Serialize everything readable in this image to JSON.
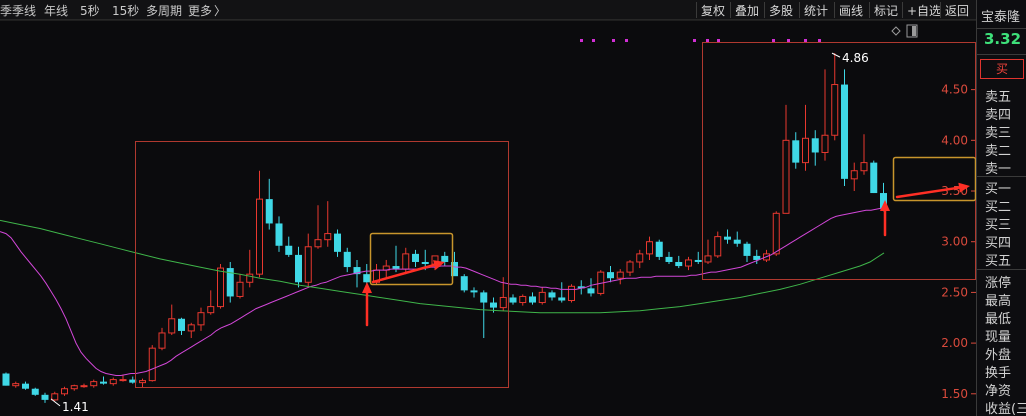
{
  "toolbar": {
    "periods": [
      "季",
      "季线",
      "年线",
      "5秒",
      "15秒",
      "多周期",
      "更多"
    ],
    "more_arrow": "〉",
    "tools": [
      "复权",
      "叠加",
      "多股",
      "统计",
      "画线",
      "标记",
      "+自选",
      "返回"
    ]
  },
  "stock": {
    "name": "宝泰隆",
    "price": "3.32",
    "buy_label": "买"
  },
  "orderbook": {
    "sell": [
      "卖五",
      "卖四",
      "卖三",
      "卖二",
      "卖一"
    ],
    "buy": [
      "买一",
      "买二",
      "买三",
      "买四",
      "买五"
    ]
  },
  "stats": [
    "涨停",
    "最高",
    "最低",
    "现量",
    "外盘",
    "换手",
    "净资",
    "收益(三)"
  ],
  "colors": {
    "up": "#e8382f",
    "down": "#3fd8e6",
    "ma_short": "#d247d8",
    "ma_long": "#3fb54a",
    "box_red": "#b0392f",
    "box_gold": "#c8952c",
    "arrow": "#ff2f25",
    "marker": "#d12fd4",
    "axis_text": "#d94a3c"
  },
  "chart_data": {
    "type": "candlestick",
    "ylim": [
      1.35,
      4.95
    ],
    "y_ticks": [
      "4.50",
      "4.00",
      "3.50",
      "3.00",
      "2.50",
      "2.00",
      "1.50"
    ],
    "ohlc": [
      [
        1.7,
        1.71,
        1.58,
        1.58
      ],
      [
        1.58,
        1.62,
        1.56,
        1.6
      ],
      [
        1.6,
        1.62,
        1.54,
        1.55
      ],
      [
        1.55,
        1.56,
        1.48,
        1.49
      ],
      [
        1.49,
        1.51,
        1.41,
        1.44
      ],
      [
        1.44,
        1.52,
        1.43,
        1.5
      ],
      [
        1.5,
        1.57,
        1.48,
        1.55
      ],
      [
        1.55,
        1.59,
        1.53,
        1.58
      ],
      [
        1.58,
        1.6,
        1.56,
        1.58
      ],
      [
        1.58,
        1.64,
        1.56,
        1.62
      ],
      [
        1.62,
        1.67,
        1.59,
        1.6
      ],
      [
        1.6,
        1.66,
        1.58,
        1.64
      ],
      [
        1.64,
        1.69,
        1.62,
        1.64
      ],
      [
        1.64,
        1.67,
        1.6,
        1.61
      ],
      [
        1.61,
        1.65,
        1.56,
        1.63
      ],
      [
        1.63,
        1.98,
        1.62,
        1.95
      ],
      [
        1.95,
        2.15,
        1.93,
        2.1
      ],
      [
        2.1,
        2.38,
        2.08,
        2.24
      ],
      [
        2.24,
        2.25,
        2.08,
        2.12
      ],
      [
        2.12,
        2.2,
        2.05,
        2.18
      ],
      [
        2.18,
        2.35,
        2.12,
        2.3
      ],
      [
        2.3,
        2.52,
        2.28,
        2.36
      ],
      [
        2.36,
        2.78,
        2.34,
        2.74
      ],
      [
        2.74,
        2.8,
        2.4,
        2.46
      ],
      [
        2.46,
        2.68,
        2.44,
        2.6
      ],
      [
        2.6,
        2.92,
        2.55,
        2.68
      ],
      [
        2.68,
        3.7,
        2.65,
        3.42
      ],
      [
        3.42,
        3.62,
        3.12,
        3.18
      ],
      [
        3.18,
        3.25,
        2.9,
        2.96
      ],
      [
        2.96,
        3.05,
        2.85,
        2.87
      ],
      [
        2.87,
        2.95,
        2.55,
        2.6
      ],
      [
        2.6,
        3.08,
        2.55,
        2.95
      ],
      [
        2.95,
        3.36,
        2.93,
        3.02
      ],
      [
        3.02,
        3.4,
        2.95,
        3.08
      ],
      [
        3.08,
        3.12,
        2.85,
        2.9
      ],
      [
        2.9,
        2.94,
        2.7,
        2.75
      ],
      [
        2.75,
        2.82,
        2.55,
        2.68
      ],
      [
        2.68,
        2.78,
        2.58,
        2.6
      ],
      [
        2.6,
        2.78,
        2.58,
        2.72
      ],
      [
        2.72,
        2.82,
        2.65,
        2.76
      ],
      [
        2.76,
        2.96,
        2.7,
        2.73
      ],
      [
        2.73,
        2.94,
        2.68,
        2.88
      ],
      [
        2.88,
        2.92,
        2.75,
        2.8
      ],
      [
        2.8,
        2.92,
        2.72,
        2.78
      ],
      [
        2.78,
        2.86,
        2.72,
        2.86
      ],
      [
        2.86,
        2.9,
        2.76,
        2.8
      ],
      [
        2.8,
        2.9,
        2.7,
        2.66
      ],
      [
        2.66,
        2.68,
        2.5,
        2.52
      ],
      [
        2.52,
        2.55,
        2.45,
        2.5
      ],
      [
        2.5,
        2.52,
        2.05,
        2.4
      ],
      [
        2.4,
        2.45,
        2.3,
        2.35
      ],
      [
        2.35,
        2.65,
        2.32,
        2.45
      ],
      [
        2.45,
        2.48,
        2.38,
        2.4
      ],
      [
        2.4,
        2.48,
        2.37,
        2.46
      ],
      [
        2.46,
        2.5,
        2.38,
        2.4
      ],
      [
        2.4,
        2.55,
        2.38,
        2.5
      ],
      [
        2.5,
        2.52,
        2.42,
        2.45
      ],
      [
        2.45,
        2.6,
        2.4,
        2.42
      ],
      [
        2.42,
        2.58,
        2.4,
        2.56
      ],
      [
        2.56,
        2.62,
        2.48,
        2.54
      ],
      [
        2.54,
        2.64,
        2.46,
        2.49
      ],
      [
        2.49,
        2.72,
        2.47,
        2.7
      ],
      [
        2.7,
        2.76,
        2.6,
        2.64
      ],
      [
        2.64,
        2.73,
        2.58,
        2.7
      ],
      [
        2.7,
        2.82,
        2.66,
        2.8
      ],
      [
        2.8,
        2.92,
        2.74,
        2.88
      ],
      [
        2.88,
        3.05,
        2.82,
        3.0
      ],
      [
        3.0,
        3.02,
        2.82,
        2.85
      ],
      [
        2.85,
        2.9,
        2.78,
        2.8
      ],
      [
        2.8,
        2.86,
        2.74,
        2.76
      ],
      [
        2.76,
        2.85,
        2.72,
        2.82
      ],
      [
        2.82,
        2.9,
        2.78,
        2.8
      ],
      [
        2.8,
        3.02,
        2.78,
        2.86
      ],
      [
        2.86,
        3.1,
        2.84,
        3.05
      ],
      [
        3.05,
        3.12,
        2.98,
        3.02
      ],
      [
        3.02,
        3.1,
        2.95,
        2.98
      ],
      [
        2.98,
        3.0,
        2.8,
        2.86
      ],
      [
        2.86,
        2.92,
        2.78,
        2.82
      ],
      [
        2.82,
        2.92,
        2.8,
        2.88
      ],
      [
        2.88,
        3.3,
        2.86,
        3.28
      ],
      [
        3.28,
        4.35,
        3.45,
        4.0
      ],
      [
        4.0,
        4.08,
        3.72,
        3.78
      ],
      [
        3.78,
        4.35,
        3.7,
        4.02
      ],
      [
        4.02,
        4.1,
        3.75,
        3.88
      ],
      [
        3.88,
        4.7,
        3.8,
        4.05
      ],
      [
        4.05,
        4.86,
        4.0,
        4.55
      ],
      [
        4.55,
        4.7,
        3.55,
        3.62
      ],
      [
        3.62,
        3.78,
        3.5,
        3.7
      ],
      [
        3.7,
        4.06,
        3.66,
        3.78
      ],
      [
        3.78,
        3.8,
        3.48,
        3.48
      ],
      [
        3.48,
        3.58,
        3.3,
        3.32
      ]
    ],
    "ma_short": [
      [
        0,
        3.1
      ],
      [
        6,
        3.08
      ],
      [
        11,
        3.04
      ],
      [
        16,
        2.97
      ],
      [
        21,
        2.9
      ],
      [
        26,
        2.84
      ],
      [
        31,
        2.78
      ],
      [
        36,
        2.72
      ],
      [
        41,
        2.66
      ],
      [
        46,
        2.59
      ],
      [
        51,
        2.51
      ],
      [
        56,
        2.43
      ],
      [
        61,
        2.34
      ],
      [
        66,
        2.24
      ],
      [
        71,
        2.12
      ],
      [
        76,
        2.0
      ],
      [
        81,
        1.91
      ],
      [
        86,
        1.85
      ],
      [
        91,
        1.8
      ],
      [
        96,
        1.75
      ],
      [
        101,
        1.72
      ],
      [
        106,
        1.7
      ],
      [
        111,
        1.69
      ],
      [
        116,
        1.68
      ],
      [
        121,
        1.68
      ],
      [
        126,
        1.69
      ],
      [
        131,
        1.7
      ],
      [
        136,
        1.7
      ],
      [
        141,
        1.71
      ],
      [
        146,
        1.72
      ],
      [
        151,
        1.74
      ],
      [
        156,
        1.76
      ],
      [
        161,
        1.78
      ],
      [
        166,
        1.8
      ],
      [
        171,
        1.83
      ],
      [
        176,
        1.87
      ],
      [
        181,
        1.9
      ],
      [
        186,
        1.93
      ],
      [
        191,
        1.96
      ],
      [
        196,
        1.99
      ],
      [
        201,
        2.02
      ],
      [
        206,
        2.05
      ],
      [
        211,
        2.08
      ],
      [
        216,
        2.12
      ],
      [
        221,
        2.15
      ],
      [
        226,
        2.17
      ],
      [
        231,
        2.19
      ],
      [
        236,
        2.22
      ],
      [
        241,
        2.25
      ],
      [
        246,
        2.28
      ],
      [
        251,
        2.31
      ],
      [
        256,
        2.34
      ],
      [
        261,
        2.36
      ],
      [
        266,
        2.38
      ],
      [
        271,
        2.4
      ],
      [
        276,
        2.42
      ],
      [
        281,
        2.44
      ],
      [
        286,
        2.46
      ],
      [
        291,
        2.48
      ],
      [
        296,
        2.5
      ],
      [
        301,
        2.52
      ],
      [
        306,
        2.54
      ],
      [
        311,
        2.56
      ],
      [
        316,
        2.57
      ],
      [
        321,
        2.59
      ],
      [
        326,
        2.6
      ],
      [
        331,
        2.62
      ],
      [
        336,
        2.64
      ],
      [
        341,
        2.66
      ],
      [
        346,
        2.67
      ],
      [
        351,
        2.68
      ],
      [
        356,
        2.69
      ],
      [
        361,
        2.7
      ],
      [
        366,
        2.71
      ],
      [
        371,
        2.71
      ],
      [
        376,
        2.72
      ],
      [
        381,
        2.72
      ],
      [
        386,
        2.72
      ],
      [
        391,
        2.73
      ],
      [
        396,
        2.73
      ],
      [
        401,
        2.73
      ],
      [
        406,
        2.73
      ],
      [
        411,
        2.73
      ],
      [
        416,
        2.73
      ],
      [
        421,
        2.73
      ],
      [
        426,
        2.74
      ],
      [
        431,
        2.75
      ],
      [
        436,
        2.75
      ],
      [
        441,
        2.76
      ],
      [
        446,
        2.76
      ],
      [
        451,
        2.76
      ],
      [
        456,
        2.75
      ],
      [
        461,
        2.75
      ],
      [
        466,
        2.74
      ],
      [
        471,
        2.72
      ],
      [
        476,
        2.7
      ],
      [
        481,
        2.68
      ],
      [
        486,
        2.66
      ],
      [
        491,
        2.64
      ],
      [
        496,
        2.62
      ],
      [
        501,
        2.6
      ],
      [
        506,
        2.59
      ],
      [
        511,
        2.58
      ],
      [
        516,
        2.58
      ],
      [
        521,
        2.57
      ],
      [
        526,
        2.57
      ],
      [
        531,
        2.56
      ],
      [
        536,
        2.56
      ],
      [
        541,
        2.55
      ],
      [
        546,
        2.55
      ],
      [
        551,
        2.54
      ],
      [
        556,
        2.54
      ],
      [
        561,
        2.53
      ],
      [
        566,
        2.53
      ],
      [
        571,
        2.53
      ],
      [
        576,
        2.53
      ],
      [
        581,
        2.54
      ],
      [
        586,
        2.55
      ],
      [
        591,
        2.57
      ],
      [
        596,
        2.58
      ],
      [
        601,
        2.59
      ],
      [
        606,
        2.6
      ],
      [
        611,
        2.61
      ],
      [
        616,
        2.62
      ],
      [
        621,
        2.63
      ],
      [
        626,
        2.64
      ],
      [
        631,
        2.64
      ],
      [
        636,
        2.64
      ],
      [
        641,
        2.65
      ],
      [
        646,
        2.65
      ],
      [
        651,
        2.65
      ],
      [
        656,
        2.66
      ],
      [
        661,
        2.66
      ],
      [
        666,
        2.66
      ],
      [
        671,
        2.66
      ],
      [
        676,
        2.66
      ],
      [
        681,
        2.66
      ],
      [
        686,
        2.66
      ],
      [
        691,
        2.67
      ],
      [
        696,
        2.67
      ],
      [
        701,
        2.68
      ],
      [
        706,
        2.69
      ],
      [
        711,
        2.7
      ],
      [
        716,
        2.7
      ],
      [
        721,
        2.71
      ],
      [
        726,
        2.72
      ],
      [
        731,
        2.73
      ],
      [
        736,
        2.74
      ],
      [
        741,
        2.75
      ],
      [
        746,
        2.77
      ],
      [
        751,
        2.79
      ],
      [
        756,
        2.81
      ],
      [
        761,
        2.83
      ],
      [
        766,
        2.85
      ],
      [
        771,
        2.87
      ],
      [
        776,
        2.9
      ],
      [
        781,
        2.93
      ],
      [
        786,
        2.96
      ],
      [
        791,
        2.99
      ],
      [
        796,
        3.02
      ],
      [
        801,
        3.05
      ],
      [
        806,
        3.08
      ],
      [
        811,
        3.11
      ],
      [
        816,
        3.14
      ],
      [
        821,
        3.17
      ],
      [
        826,
        3.2
      ],
      [
        831,
        3.23
      ],
      [
        836,
        3.25
      ],
      [
        841,
        3.26
      ],
      [
        846,
        3.27
      ],
      [
        851,
        3.28
      ],
      [
        856,
        3.29
      ],
      [
        861,
        3.3
      ],
      [
        866,
        3.31
      ],
      [
        871,
        3.31
      ],
      [
        876,
        3.32
      ],
      [
        881,
        3.33
      ],
      [
        884,
        3.34
      ]
    ],
    "ma_long": [
      [
        0,
        3.21
      ],
      [
        20,
        3.17
      ],
      [
        40,
        3.13
      ],
      [
        60,
        3.08
      ],
      [
        80,
        3.03
      ],
      [
        100,
        2.98
      ],
      [
        120,
        2.93
      ],
      [
        140,
        2.88
      ],
      [
        160,
        2.83
      ],
      [
        180,
        2.79
      ],
      [
        200,
        2.75
      ],
      [
        220,
        2.71
      ],
      [
        240,
        2.68
      ],
      [
        260,
        2.64
      ],
      [
        280,
        2.61
      ],
      [
        300,
        2.57
      ],
      [
        320,
        2.54
      ],
      [
        340,
        2.51
      ],
      [
        360,
        2.48
      ],
      [
        380,
        2.45
      ],
      [
        400,
        2.42
      ],
      [
        420,
        2.39
      ],
      [
        440,
        2.37
      ],
      [
        460,
        2.35
      ],
      [
        480,
        2.33
      ],
      [
        500,
        2.32
      ],
      [
        520,
        2.31
      ],
      [
        540,
        2.3
      ],
      [
        560,
        2.3
      ],
      [
        580,
        2.3
      ],
      [
        600,
        2.3
      ],
      [
        620,
        2.31
      ],
      [
        640,
        2.32
      ],
      [
        660,
        2.34
      ],
      [
        680,
        2.36
      ],
      [
        700,
        2.39
      ],
      [
        720,
        2.42
      ],
      [
        740,
        2.45
      ],
      [
        760,
        2.49
      ],
      [
        780,
        2.53
      ],
      [
        800,
        2.58
      ],
      [
        820,
        2.64
      ],
      [
        840,
        2.7
      ],
      [
        860,
        2.76
      ],
      [
        870,
        2.8
      ],
      [
        884,
        2.89
      ]
    ],
    "annotations": [
      "4.86",
      "1.41"
    ]
  }
}
